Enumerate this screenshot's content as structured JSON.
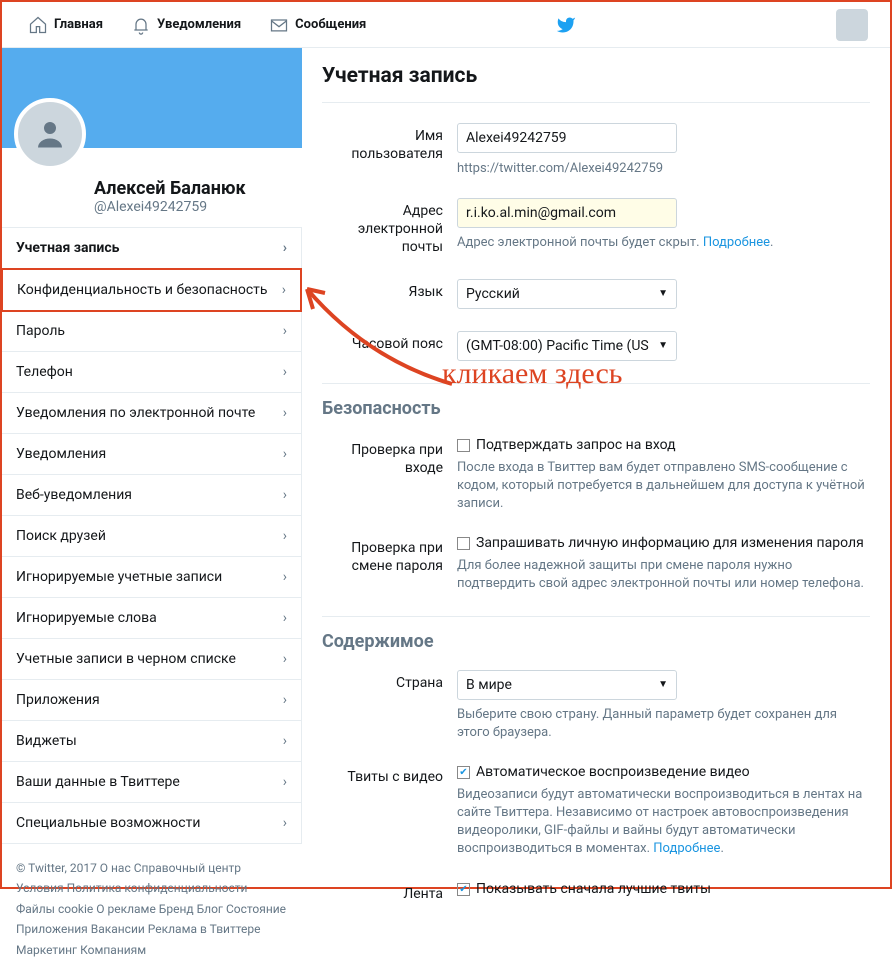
{
  "nav": {
    "home": "Главная",
    "notifications": "Уведомления",
    "messages": "Сообщения"
  },
  "profile": {
    "name": "Алексей Баланюк",
    "handle": "@Alexei49242759"
  },
  "menu": {
    "items": [
      {
        "label": "Учетная запись"
      },
      {
        "label": "Конфиденциальность и безопасность"
      },
      {
        "label": "Пароль"
      },
      {
        "label": "Телефон"
      },
      {
        "label": "Уведомления по электронной почте"
      },
      {
        "label": "Уведомления"
      },
      {
        "label": "Веб-уведомления"
      },
      {
        "label": "Поиск друзей"
      },
      {
        "label": "Игнорируемые учетные записи"
      },
      {
        "label": "Игнорируемые слова"
      },
      {
        "label": "Учетные записи в черном списке"
      },
      {
        "label": "Приложения"
      },
      {
        "label": "Виджеты"
      },
      {
        "label": "Ваши данные в Твиттере"
      },
      {
        "label": "Специальные возможности"
      }
    ]
  },
  "footer": "© Twitter, 2017 О нас Справочный центр Условия Политика конфиденциальности Файлы cookie О рекламе Бренд Блог Состояние Приложения Вакансии Реклама в Твиттере Маркетинг Компаниям",
  "page": {
    "title": "Учетная запись",
    "username_label": "Имя пользователя",
    "username_value": "Alexei49242759",
    "profile_url": "https://twitter.com/Alexei49242759",
    "email_label": "Адрес электронной почты",
    "email_value": "r.i.ko.al.min@gmail.com",
    "email_help": "Адрес электронной почты будет скрыт.",
    "more": "Подробнее",
    "language_label": "Язык",
    "language_value": "Русский",
    "timezone_label": "Часовой пояс",
    "timezone_value": "(GMT-08:00) Pacific Time (US",
    "security_title": "Безопасность",
    "login_verify_label": "Проверка при входе",
    "login_verify_check": "Подтверждать запрос на вход",
    "login_verify_help": "После входа в Твиттер вам будет отправлено SMS-сообщение с кодом, который потребуется в дальнейшем для доступа к учётной записи.",
    "pw_change_label": "Проверка при смене пароля",
    "pw_change_check": "Запрашивать личную информацию для изменения пароля",
    "pw_change_help": "Для более надежной защиты при смене пароля нужно подтвердить свой адрес электронной почты или номер телефона.",
    "content_title": "Содержимое",
    "country_label": "Страна",
    "country_value": "В мире",
    "country_help": "Выберите свою страну. Данный параметр будет сохранен для этого браузера.",
    "video_label": "Твиты с видео",
    "video_check": "Автоматическое воспроизведение видео",
    "video_help": "Видеозаписи будут автоматически воспроизводиться в лентах на сайте Твиттера. Независимо от настроек автовоспроизведения видеоролики, GIF-файлы и вайны будут автоматически воспроизводиться в моментах.",
    "feed_label": "Лента",
    "feed_check": "Показывать сначала лучшие твиты"
  },
  "annotation": "кликаем здесь"
}
